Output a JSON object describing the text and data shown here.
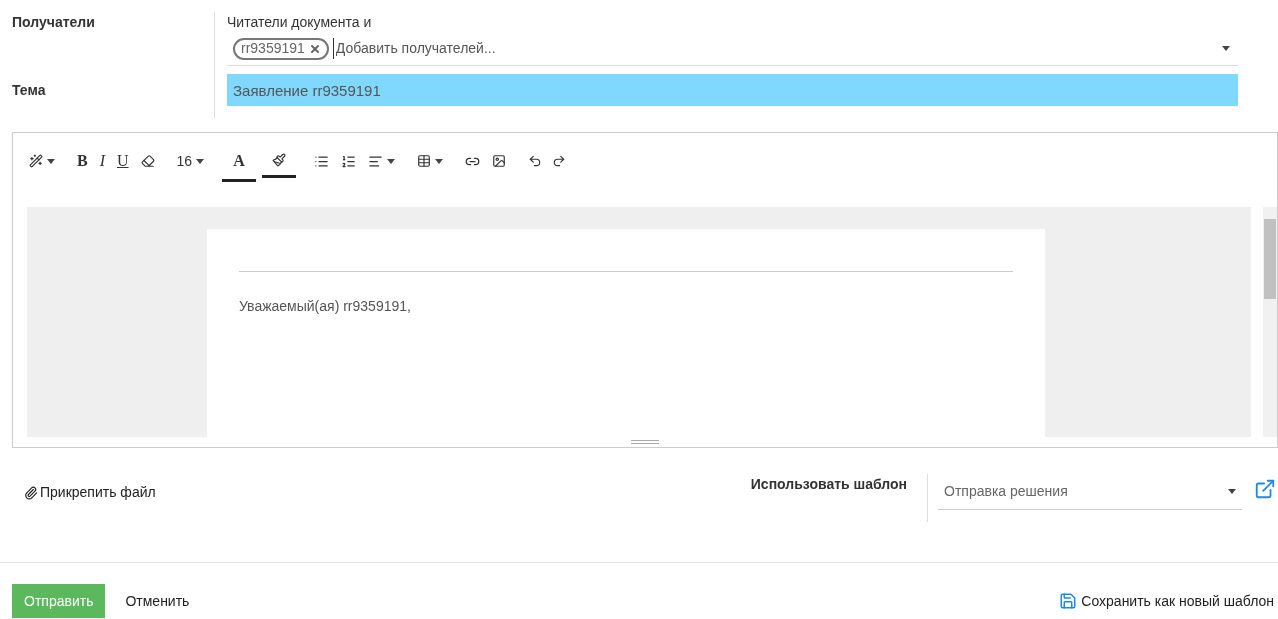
{
  "recipients": {
    "label": "Получатели",
    "note": "Читатели документа и",
    "tags": [
      {
        "text": "rr9359191"
      }
    ],
    "placeholder": "Добавить получателей..."
  },
  "subject": {
    "label": "Тема",
    "value": "Заявление rr9359191"
  },
  "toolbar": {
    "bold": "B",
    "italic": "I",
    "underline": "U",
    "font_size": "16",
    "font_color": "A"
  },
  "editor": {
    "body": "Уважаемый(ая) rr9359191,"
  },
  "attach": {
    "label": "Прикрепить файл"
  },
  "template": {
    "label": "Использовать шаблон",
    "value": "Отправка решения"
  },
  "actions": {
    "send": "Отправить",
    "cancel": "Отменить",
    "save_template": "Сохранить как новый шаблон"
  }
}
